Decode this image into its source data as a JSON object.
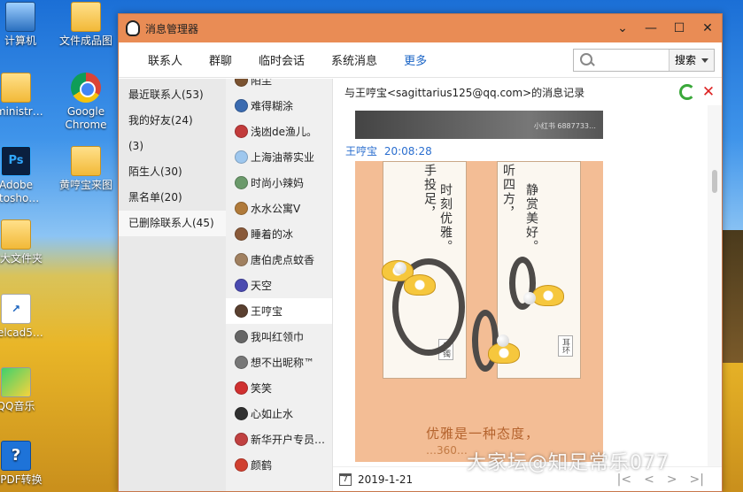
{
  "desktop": {
    "icons": [
      {
        "label": "计算机",
        "icon": "computer-icon"
      },
      {
        "label": "文件成品图",
        "icon": "folder-icon"
      },
      {
        "label": "dministr…",
        "icon": "user-folder-icon"
      },
      {
        "label": "Google Chrome",
        "icon": "chrome-icon"
      },
      {
        "label": "Adobe otosho…",
        "icon": "photoshop-icon"
      },
      {
        "label": "黄哼宝来图",
        "icon": "folder-icon"
      },
      {
        "label": "金大文件夹",
        "icon": "folder-icon"
      },
      {
        "label": "welcad5…",
        "icon": "app-shortcut-icon"
      },
      {
        "label": "QQ音乐",
        "icon": "qq-music-icon"
      },
      {
        "label": "刻PDF转换",
        "icon": "pdf-converter-icon"
      }
    ],
    "watermark": "大家坛@知足常乐077"
  },
  "window": {
    "title": "消息管理器",
    "controls": {
      "collapse": "⌄",
      "minimize": "—",
      "maximize": "☐",
      "close": "✕"
    }
  },
  "menubar": {
    "tabs": [
      {
        "label": "联系人",
        "active": false
      },
      {
        "label": "群聊",
        "active": false
      },
      {
        "label": "临时会话",
        "active": false
      },
      {
        "label": "系统消息",
        "active": false
      },
      {
        "label": "更多",
        "active": true
      }
    ],
    "search": {
      "placeholder": "",
      "value": "",
      "button_label": "搜索"
    }
  },
  "categories": [
    {
      "label": "最近联系人(53)",
      "active": false
    },
    {
      "label": "我的好友(24)",
      "active": false
    },
    {
      "label": "(3)",
      "active": false
    },
    {
      "label": "陌生人(30)",
      "active": false
    },
    {
      "label": "黑名单(20)",
      "active": false
    },
    {
      "label": "已删除联系人(45)",
      "active": true
    }
  ],
  "contacts": [
    {
      "name": "陌尘",
      "color": "#7a5230",
      "active": false
    },
    {
      "name": "难得糊涂",
      "color": "#3b6bb0",
      "active": false
    },
    {
      "name": "浅凼de渔儿。",
      "color": "#c23b3b",
      "active": false
    },
    {
      "name": "上海油蒂实业",
      "color": "#9ec7ee",
      "active": false
    },
    {
      "name": "时尚小辣妈",
      "color": "#6b9a6b",
      "active": false
    },
    {
      "name": "水水公寓V",
      "color": "#b07a3a",
      "active": false
    },
    {
      "name": "睡着的冰",
      "color": "#8a5a3a",
      "active": false
    },
    {
      "name": "唐伯虎点蚊香",
      "color": "#a08060",
      "active": false
    },
    {
      "name": "天空",
      "color": "#4a4ab0",
      "active": false
    },
    {
      "name": "王哼宝",
      "color": "#5a4030",
      "active": true
    },
    {
      "name": "我叫红领巾",
      "color": "#666666",
      "active": false
    },
    {
      "name": "想不出昵称™",
      "color": "#777777",
      "active": false
    },
    {
      "name": "笑笑",
      "color": "#d03030",
      "active": false
    },
    {
      "name": "心如止水",
      "color": "#303030",
      "active": false
    },
    {
      "name": "新华开户专员…",
      "color": "#c04040",
      "active": false
    },
    {
      "name": "颜鹤",
      "color": "#d04030",
      "active": false
    }
  ],
  "message_log": {
    "header": "与王哼宝<sagittarius125@qq.com>的消息记录",
    "prev_image_watermark": "小红书  6887733…",
    "sender": "王哼宝",
    "time": "20:08:28",
    "picture": {
      "card1_text_a": "手投足，",
      "card1_text_b": "时刻优雅。",
      "card1_stamp": "手镯",
      "card2_text_a": "听四方，",
      "card2_text_b": "静赏美好。",
      "card2_stamp": "耳环",
      "slogan": "优雅是一种态度，",
      "slogan2": "…360…"
    },
    "footer_date": "2019-1-21",
    "pager": {
      "first": "|<",
      "prev": "<",
      "next": ">",
      "last": ">|"
    }
  }
}
